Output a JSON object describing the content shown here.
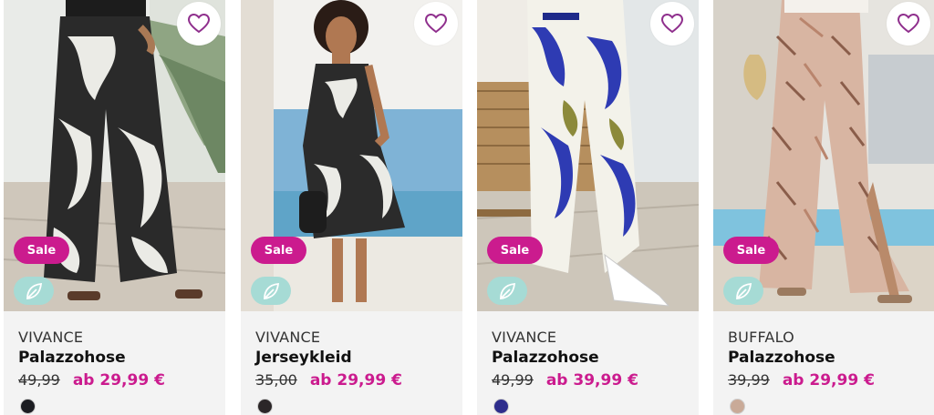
{
  "products": [
    {
      "brand": "VIVANCE",
      "name": "Palazzohose",
      "old_price": "49,99",
      "price": "ab 29,99 €",
      "badge": "Sale",
      "eco_icon": "leaf-icon",
      "wishlist_icon": "heart-icon",
      "image_description": "model-wearing-black-white-printed-wide-trousers",
      "swatch_color": "#1c1d22"
    },
    {
      "brand": "VIVANCE",
      "name": "Jerseykleid",
      "old_price": "35,00",
      "price": "ab 29,99 €",
      "badge": "Sale",
      "eco_icon": "leaf-icon",
      "wishlist_icon": "heart-icon",
      "image_description": "model-wearing-black-white-printed-dress",
      "swatch_color": "#2b2628"
    },
    {
      "brand": "VIVANCE",
      "name": "Palazzohose",
      "old_price": "49,99",
      "price": "ab 39,99 €",
      "badge": "Sale",
      "eco_icon": "leaf-icon",
      "wishlist_icon": "heart-icon",
      "image_description": "model-wearing-blue-white-printed-trousers",
      "swatch_color": "#2e2d8c"
    },
    {
      "brand": "BUFFALO",
      "name": "Palazzohose",
      "old_price": "39,99",
      "price": "ab 29,99 €",
      "badge": "Sale",
      "eco_icon": "leaf-icon",
      "wishlist_icon": "heart-icon",
      "image_description": "model-wearing-beige-snake-print-trousers",
      "swatch_color": "#c9aa98"
    }
  ],
  "colors": {
    "sale": "#cb1b8e",
    "eco_badge": "#a6dbd5",
    "wishlist_heart": "#8f2f8d",
    "card_background": "#f3f3f3"
  }
}
